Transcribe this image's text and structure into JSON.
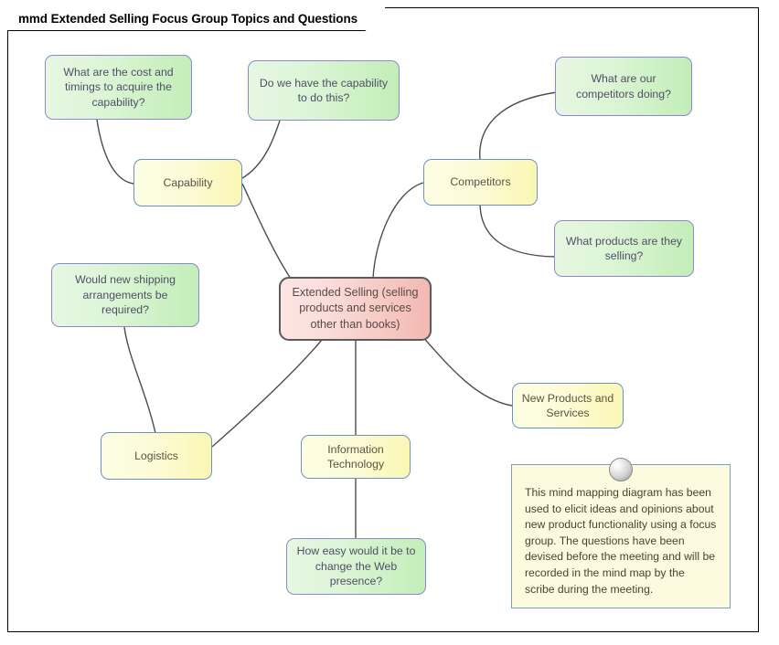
{
  "frame": {
    "title": "mmd Extended Selling Focus Group Topics and Questions"
  },
  "diagram": {
    "type": "mind-map",
    "central_node": {
      "label": "Extended Selling (selling products and services other than books)"
    },
    "topics": [
      {
        "id": "capability",
        "label": "Capability"
      },
      {
        "id": "competitors",
        "label": "Competitors"
      },
      {
        "id": "logistics",
        "label": "Logistics"
      },
      {
        "id": "information-technology",
        "label": "Information Technology"
      },
      {
        "id": "new-products-and-services",
        "label": "New Products and Services"
      }
    ],
    "questions": [
      {
        "id": "cost-and-timings",
        "label": "What are the cost and timings to acquire the capability?",
        "parent": "capability"
      },
      {
        "id": "have-capability",
        "label": "Do we have the capability to do this?",
        "parent": "capability"
      },
      {
        "id": "competitors-doing",
        "label": "What are our competitors doing?",
        "parent": "competitors"
      },
      {
        "id": "products-selling",
        "label": "What products are they selling?",
        "parent": "competitors"
      },
      {
        "id": "shipping-arrangements",
        "label": "Would new shipping arrangements be required?",
        "parent": "logistics"
      },
      {
        "id": "web-presence",
        "label": "How easy would it be to change the Web presence?",
        "parent": "information-technology"
      }
    ],
    "note": {
      "text": "This mind mapping diagram has been used to elicit ideas and opinions about new product functionality using a focus group. The questions have been devised before the meeting and will be recorded in the mind map by the scribe during the meeting."
    }
  },
  "colors": {
    "central_fill": "#f6c6c0",
    "central_border": "#5b5b5b",
    "topic_fill": "#faf7b4",
    "topic_border": "#6b93c0",
    "question_fill": "#c2eeb8",
    "question_border": "#8c87d0",
    "note_fill": "#fdfbdf",
    "note_border": "#7d9fc0",
    "connector": "#4d4d4d",
    "frame_border": "#000000"
  }
}
